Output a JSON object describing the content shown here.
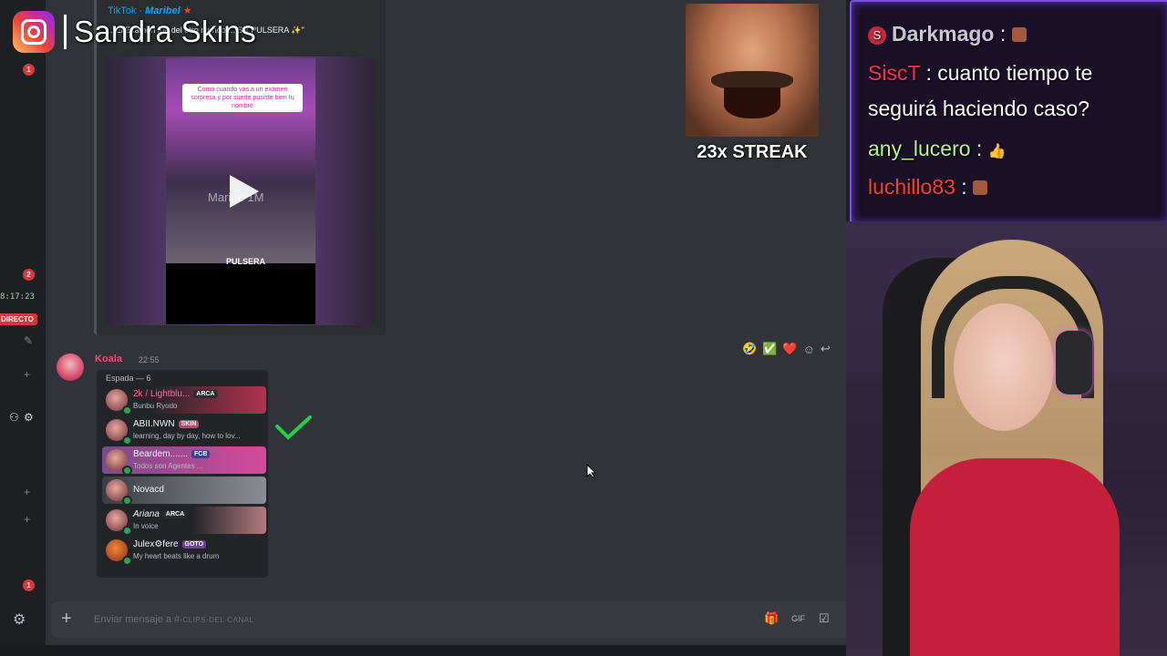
{
  "instagram_overlay": {
    "icon": "instagram-icon",
    "handle": "Sandra Skins"
  },
  "rail": {
    "badges": [
      "1",
      "2",
      "1"
    ],
    "time": "8:17:23",
    "live_label": "DIRECTO"
  },
  "tiktok_embed": {
    "provider": "TikTok",
    "separator": " · ",
    "author": "Maribel",
    "description": "...\"El Examen fue del otro mundo ... SR PULSERA ✨\"",
    "video_caption": "Como cuando vas a un exámen sorpresa y por suerte pusiste bien tu nombre",
    "watermark": "Maribe 1M",
    "bottom_text": "PULSERA"
  },
  "message": {
    "author": "Koala",
    "time": "22:55",
    "category": "Espada — 6",
    "members": [
      {
        "name": "2k / Lightblu...",
        "tag": "ARCA",
        "status": "Bunbu Ryodo",
        "color": "#ff6b9e"
      },
      {
        "name": "ABII.NWN",
        "tag": "SKIN",
        "status": "learning, day by day, how to lov...",
        "color": "#f2f3f5"
      },
      {
        "name": "Beardem.......",
        "tag": "FCB",
        "status": "Todos son Agentes ...",
        "color": "#f2f3f5"
      },
      {
        "name": "Novacd",
        "tag": "",
        "status": "",
        "color": "#f2f3f5"
      },
      {
        "name": "Ariana",
        "tag": "ARCA",
        "status": "In voice",
        "color": "#f2f3f5"
      },
      {
        "name": "Julex⚙fere",
        "tag": "GOTO",
        "status": "My heart beats like a drum",
        "color": "#f2f3f5"
      }
    ]
  },
  "reactions": [
    "🤣",
    "✅",
    "❤️"
  ],
  "composer": {
    "placeholder_prefix": "Enviar mensaje a #",
    "channel": "-CLIPS-DEL-CANAL"
  },
  "streak": {
    "label": "23x STREAK"
  },
  "twitch_chat": [
    {
      "user": "Darkmago",
      "separator": " : ",
      "text": "",
      "emote": true
    },
    {
      "user": "SiscT",
      "separator": " : ",
      "text": "cuanto tiempo te",
      "emote": false
    },
    {
      "user": "",
      "separator": "",
      "text": "seguirá haciendo caso?",
      "emote": false
    },
    {
      "user": "any_lucero",
      "separator": " : ",
      "text": "👍",
      "emote": false
    },
    {
      "user": "luchillo83",
      "separator": " : ",
      "text": "",
      "emote": true
    }
  ],
  "colors": {
    "discord_bg": "#313338",
    "accent_twitch": "#7a4fe0",
    "live": "#da373c"
  }
}
